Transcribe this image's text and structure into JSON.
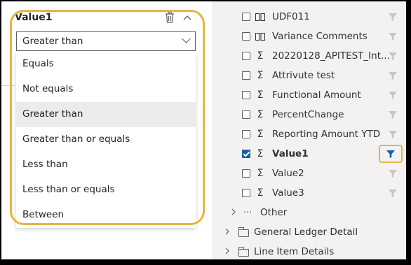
{
  "filter_card": {
    "title": "Value1",
    "select_value": "Greater than",
    "options": [
      "Equals",
      "Not equals",
      "Greater than",
      "Greater than or equals",
      "Less than",
      "Less than or equals",
      "Between"
    ],
    "selected_option": "Greater than"
  },
  "fields": [
    {
      "icon": "column-icon",
      "label": "UDF011",
      "checked": false
    },
    {
      "icon": "column-icon",
      "label": "Variance Comments",
      "checked": false
    },
    {
      "icon": "sigma-icon",
      "label": "20220128_APITEST_Int...",
      "checked": false
    },
    {
      "icon": "sigma-icon",
      "label": "Attrivute test",
      "checked": false
    },
    {
      "icon": "sigma-icon",
      "label": "Functional Amount",
      "checked": false
    },
    {
      "icon": "sigma-icon",
      "label": "PercentChange",
      "checked": false
    },
    {
      "icon": "sigma-icon",
      "label": "Reporting Amount YTD",
      "checked": false
    },
    {
      "icon": "sigma-icon",
      "label": "Value1",
      "checked": true
    },
    {
      "icon": "sigma-icon",
      "label": "Value2",
      "checked": false
    },
    {
      "icon": "sigma-icon",
      "label": "Value3",
      "checked": false
    }
  ],
  "other_group": {
    "label": "Other"
  },
  "tables": [
    {
      "label": "General Ledger Detail"
    },
    {
      "label": "Line Item Details"
    }
  ],
  "colors": {
    "accent": "#1a5ea9",
    "highlight": "#e7b442"
  }
}
